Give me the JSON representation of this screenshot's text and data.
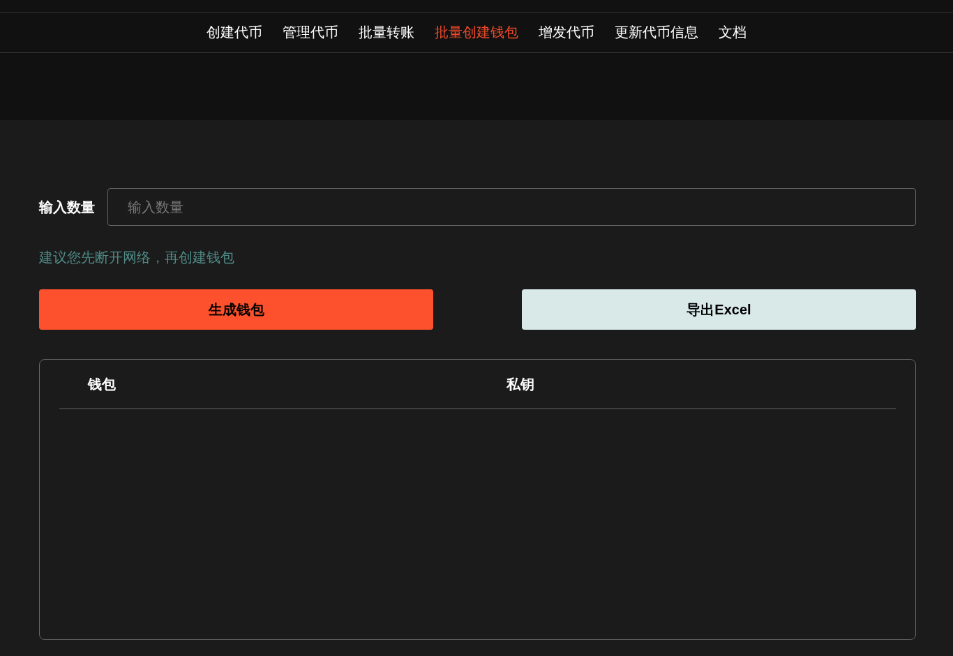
{
  "nav": [
    {
      "label": "创建代币",
      "selected": false
    },
    {
      "label": "管理代币",
      "selected": false
    },
    {
      "label": "批量转账",
      "selected": false
    },
    {
      "label": "批量创建钱包",
      "selected": true
    },
    {
      "label": "增发代币",
      "selected": false
    },
    {
      "label": "更新代币信息",
      "selected": false
    },
    {
      "label": "文档",
      "selected": false
    }
  ],
  "form": {
    "label": "输入数量",
    "placeholder": "输入数量",
    "hint": "建议您先断开网络，再创建钱包"
  },
  "buttons": [
    {
      "label": "生成钱包",
      "kind": "primary"
    },
    {
      "label": "导出Excel",
      "kind": "secondary"
    }
  ],
  "table": {
    "columns": [
      "钱包",
      "私钥"
    ]
  }
}
